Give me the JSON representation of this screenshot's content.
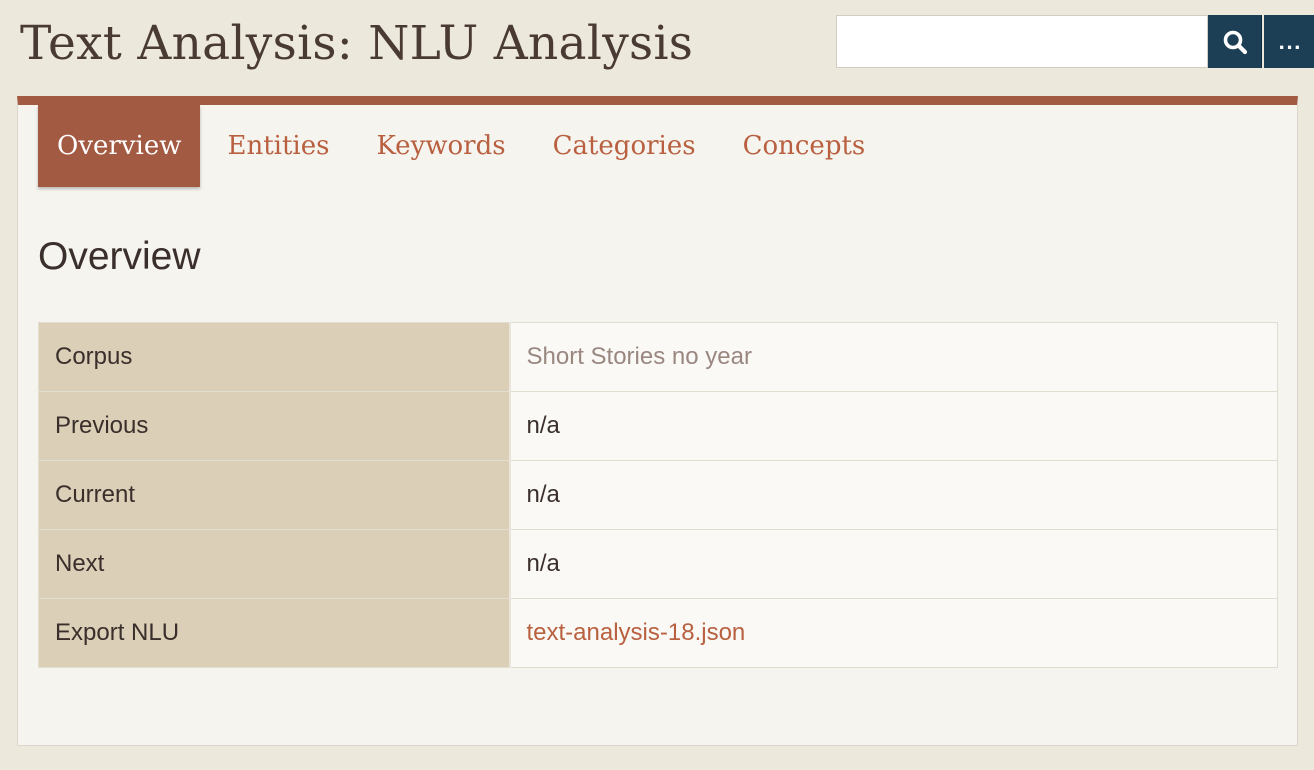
{
  "header": {
    "title": "Text Analysis: NLU Analysis"
  },
  "search": {
    "value": "",
    "placeholder": "",
    "icon": "search-icon",
    "more_label": "..."
  },
  "tabs": [
    {
      "label": "Overview",
      "active": true
    },
    {
      "label": "Entities",
      "active": false
    },
    {
      "label": "Keywords",
      "active": false
    },
    {
      "label": "Categories",
      "active": false
    },
    {
      "label": "Concepts",
      "active": false
    }
  ],
  "overview": {
    "title": "Overview",
    "rows": [
      {
        "label": "Corpus",
        "value": "Short Stories no year"
      },
      {
        "label": "Previous",
        "value": "n/a"
      },
      {
        "label": "Current",
        "value": "n/a"
      },
      {
        "label": "Next",
        "value": "n/a"
      },
      {
        "label": "Export NLU",
        "value": "text-analysis-18.json"
      }
    ]
  },
  "colors": {
    "accent": "#a35a42",
    "link": "#b8603f",
    "button": "#1c3f56",
    "label_cell": "#dbcfb8",
    "background": "#ece8dc"
  }
}
